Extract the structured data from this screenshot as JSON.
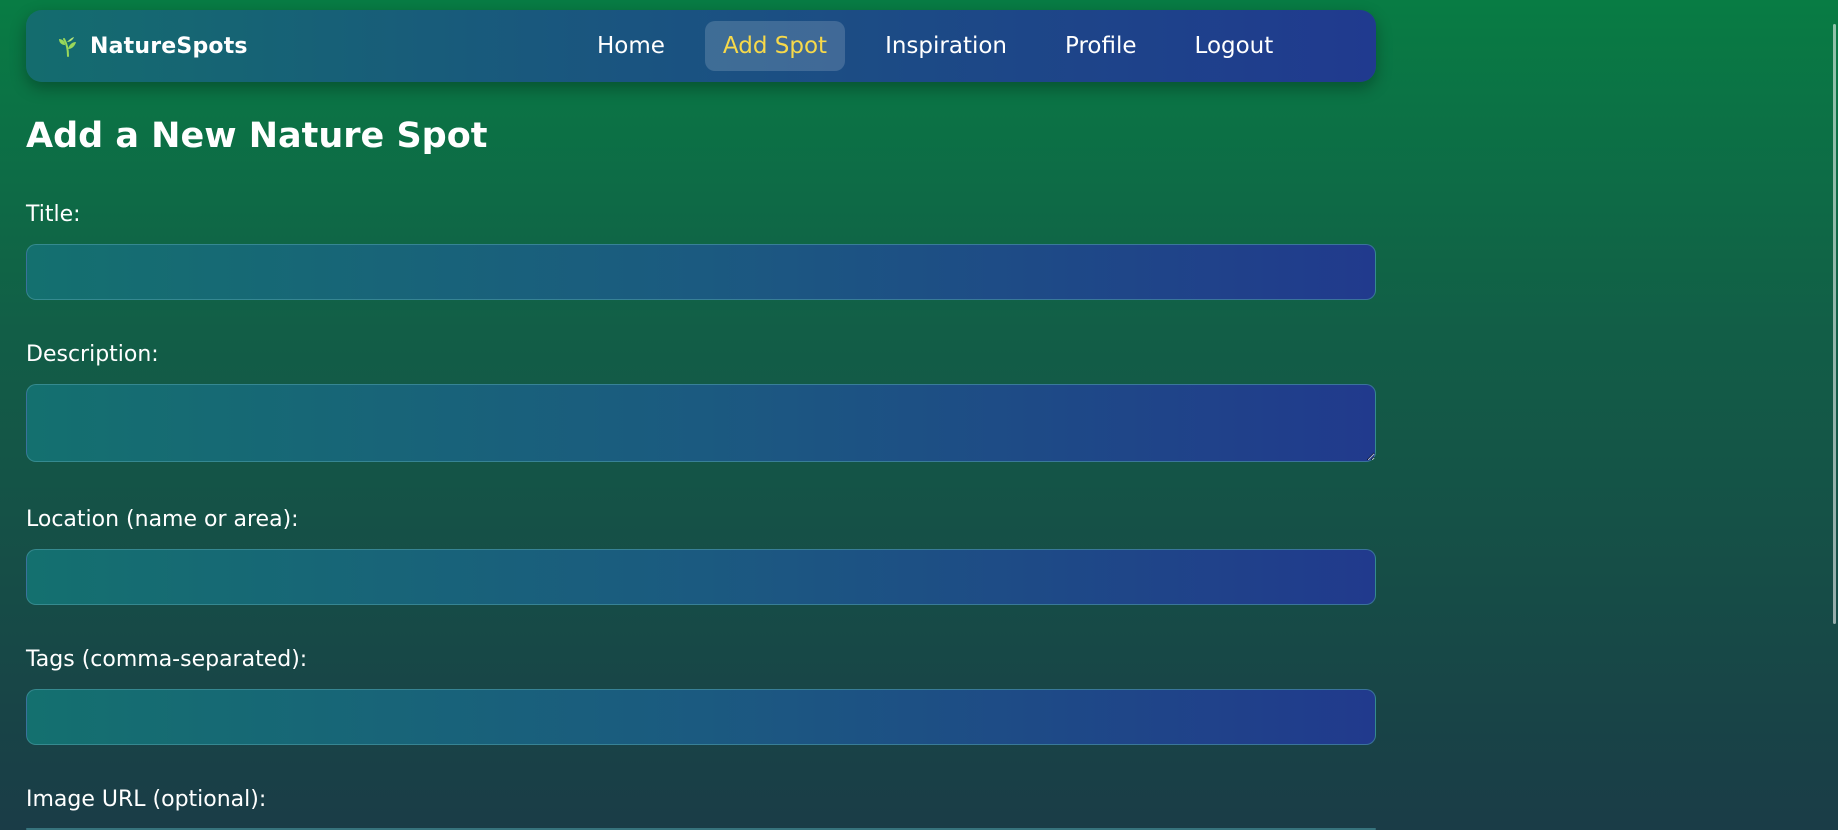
{
  "brand": {
    "name": "NatureSpots",
    "icon": "leaf-icon"
  },
  "nav": {
    "items": [
      {
        "label": "Home",
        "active": false
      },
      {
        "label": "Add Spot",
        "active": true
      },
      {
        "label": "Inspiration",
        "active": false
      },
      {
        "label": "Profile",
        "active": false
      },
      {
        "label": "Logout",
        "active": false
      }
    ]
  },
  "page": {
    "title": "Add a New Nature Spot"
  },
  "form": {
    "title": {
      "label": "Title:",
      "value": ""
    },
    "description": {
      "label": "Description:",
      "value": ""
    },
    "location": {
      "label": "Location (name or area):",
      "value": ""
    },
    "tags": {
      "label": "Tags (comma-separated):",
      "value": ""
    },
    "image_url": {
      "label": "Image URL (optional):",
      "value": ""
    }
  },
  "colors": {
    "accent": "#f7d94a",
    "background_top": "#087c44",
    "background_bottom": "#1a3c47",
    "nav_start": "#146c6e",
    "nav_end": "#203a8f"
  }
}
